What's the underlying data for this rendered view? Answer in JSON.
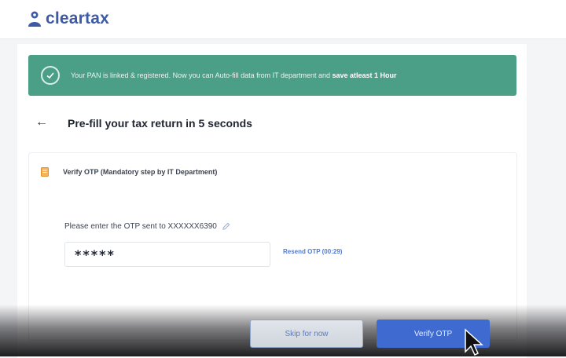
{
  "brand": {
    "name": "cleartax",
    "logo_color": "#3c5aa6"
  },
  "banner": {
    "message": "Your PAN is linked & registered. Now you can Auto-fill data from IT department and ",
    "highlight": "save atleast 1 Hour",
    "icon": "check-circle-icon",
    "color": "#4a9f86"
  },
  "header": {
    "back_icon": "arrow-left-icon",
    "title": "Pre-fill your tax return in 5 seconds"
  },
  "step": {
    "icon": "document-icon",
    "title": "Verify OTP (Mandatory step by IT Department)"
  },
  "otp": {
    "label": "Please enter the OTP sent to XXXXXX6390",
    "edit_icon": "pencil-icon",
    "value": "*****",
    "resend_label": "Resend OTP (00:29)"
  },
  "actions": {
    "skip_label": "Skip for now",
    "verify_label": "Verify OTP",
    "primary_color": "#3f6bd0"
  }
}
